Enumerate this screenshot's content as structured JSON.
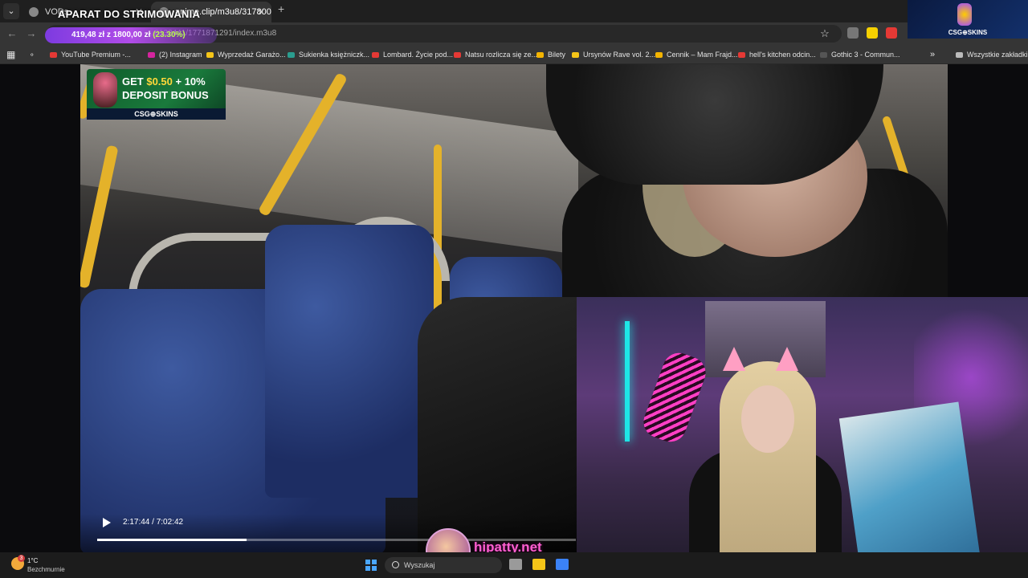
{
  "browser": {
    "tabs": [
      {
        "label": "VODs",
        "active": false
      },
      {
        "label": "anime.clip/m3u8/3178001",
        "active": true
      }
    ],
    "url": "...0132441/1771871291/index.m3u8",
    "bookmarks": [
      {
        "label": "YouTube Premium -...",
        "color": "#e53935"
      },
      {
        "label": "(2) Instagram",
        "color": "#d6249f"
      },
      {
        "label": "Wyprzedaż Garażo...",
        "color": "#f5c518"
      },
      {
        "label": "Sukienka księżniczk...",
        "color": "#2a9d8f"
      },
      {
        "label": "Lombard. Życie pod...",
        "color": "#e53935"
      },
      {
        "label": "Natsu rozlicza się ze...",
        "color": "#e53935"
      },
      {
        "label": "Bilety",
        "color": "#f4b400"
      },
      {
        "label": "Ursynów Rave vol. 2...",
        "color": "#f5c518"
      },
      {
        "label": "Cennik – Mam Frajd...",
        "color": "#f4b400"
      },
      {
        "label": "hell's kitchen odcin...",
        "color": "#e53935"
      },
      {
        "label": "Gothic 3 - Commun...",
        "color": "#555555"
      }
    ],
    "all_bookmarks": "Wszystkie zakładki"
  },
  "overlay": {
    "title": "APARAT DO STRIMOWANIA",
    "goal_text": "419,48 zł z 1800,00 zł",
    "goal_pct": "(23.30%)",
    "goal_progress": 0.233,
    "ad_line1_a": "GET ",
    "ad_line1_b": "$0.50",
    "ad_line1_c": " + 10%",
    "ad_line2": "DEPOSIT BONUS",
    "ad_brand": "CSG⊕SKINS",
    "ad_small_brand": "CSG⊕SKINS",
    "website": "hipatty.net"
  },
  "player": {
    "time": "2:17:44 / 7:02:42",
    "progress": 0.3127
  },
  "taskbar": {
    "temperature": "1°C",
    "condition": "Bezchmurnie",
    "weather_badge": "3",
    "search_placeholder": "Wyszukaj"
  }
}
